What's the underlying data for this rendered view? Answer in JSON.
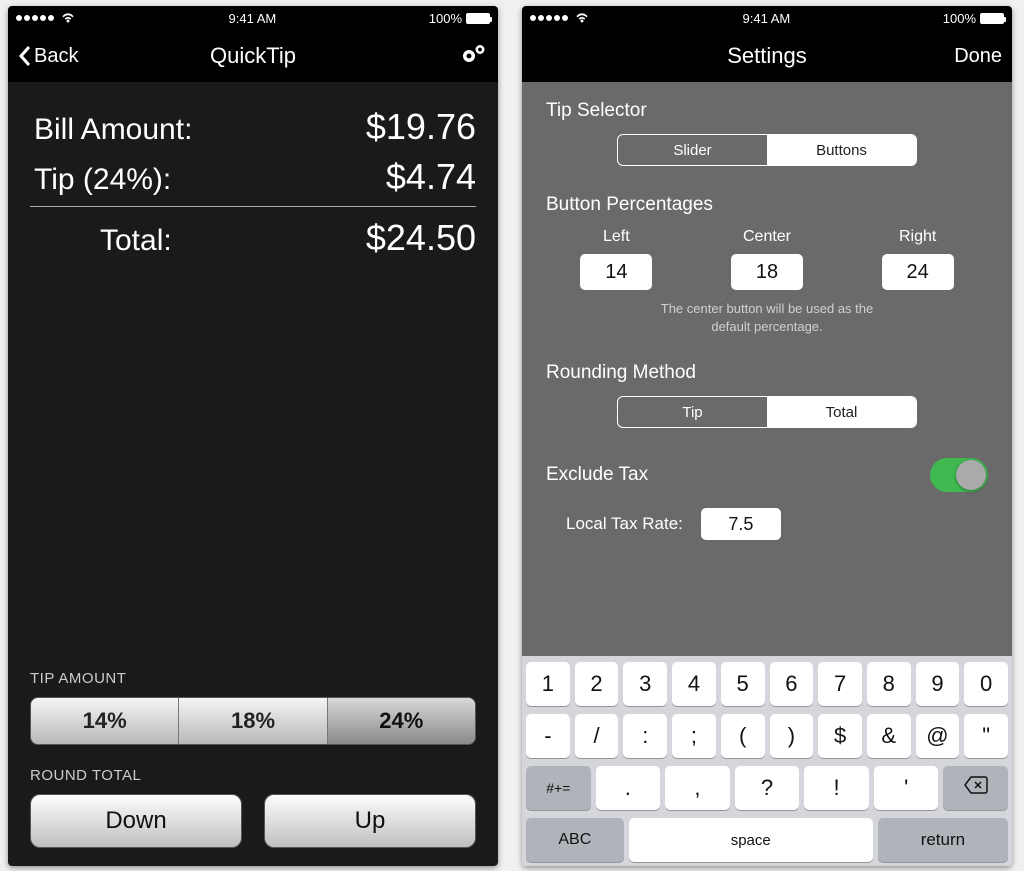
{
  "statusbar": {
    "time": "9:41 AM",
    "battery": "100%"
  },
  "left": {
    "nav": {
      "back": "Back",
      "title": "QuickTip"
    },
    "bill_label": "Bill Amount:",
    "bill_value": "$19.76",
    "tip_label": "Tip (24%):",
    "tip_value": "$4.74",
    "total_label": "Total:",
    "total_value": "$24.50",
    "tip_section": "TIP AMOUNT",
    "tip_options": [
      "14%",
      "18%",
      "24%"
    ],
    "tip_selected_index": 2,
    "round_section": "ROUND TOTAL",
    "round_down": "Down",
    "round_up": "Up"
  },
  "right": {
    "nav": {
      "title": "Settings",
      "done": "Done"
    },
    "tip_selector_label": "Tip Selector",
    "tip_selector": {
      "options": [
        "Slider",
        "Buttons"
      ],
      "selected": 1
    },
    "button_pct_label": "Button Percentages",
    "pct_headers": [
      "Left",
      "Center",
      "Right"
    ],
    "pct_values": [
      "14",
      "18",
      "24"
    ],
    "pct_hint1": "The center button will be used as the",
    "pct_hint2": "default percentage.",
    "rounding_label": "Rounding Method",
    "rounding": {
      "options": [
        "Tip",
        "Total"
      ],
      "selected": 1
    },
    "exclude_tax_label": "Exclude Tax",
    "local_tax_label": "Local Tax Rate:",
    "local_tax_value": "7.5",
    "keyboard": {
      "row1": [
        "1",
        "2",
        "3",
        "4",
        "5",
        "6",
        "7",
        "8",
        "9",
        "0"
      ],
      "row2": [
        "-",
        "/",
        ":",
        ";",
        "(",
        ")",
        "$",
        "&",
        "@",
        "\""
      ],
      "row3_shift": "#+=",
      "row3": [
        ".",
        ",",
        "?",
        "!",
        "'"
      ],
      "abc": "ABC",
      "space": "space",
      "ret": "return"
    }
  }
}
